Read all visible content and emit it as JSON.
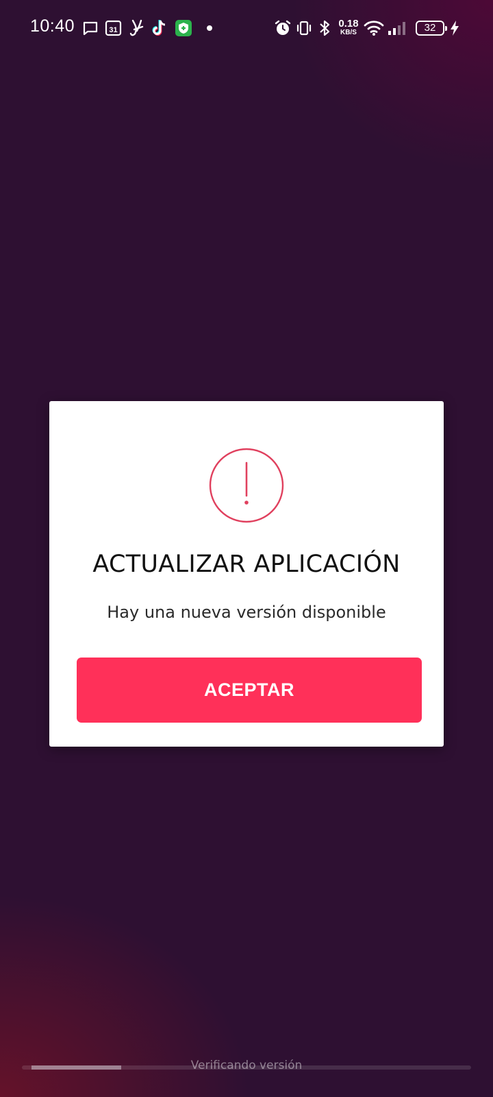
{
  "status_bar": {
    "time": "10:40",
    "calendar_day": "31",
    "net_speed_value": "0.18",
    "net_speed_unit": "KB/S",
    "battery_level": "32",
    "icons": [
      "message-icon",
      "calendar-icon",
      "app-y-icon",
      "tiktok-icon",
      "shield-icon",
      "notification-dot",
      "alarm-icon",
      "vibrate-icon",
      "bluetooth-icon",
      "wifi-icon",
      "signal-icon",
      "battery-icon",
      "charging-icon"
    ]
  },
  "dialog": {
    "icon": "alert-circle-icon",
    "title": "ACTUALIZAR APLICACIÓN",
    "message": "Hay una nueva versión disponible",
    "accept_label": "ACEPTAR"
  },
  "progress": {
    "value": 0.2,
    "label": "Verificando versión"
  },
  "colors": {
    "accent": "#ff3059",
    "icon_red": "#e0405e",
    "background": "#2e1032"
  }
}
